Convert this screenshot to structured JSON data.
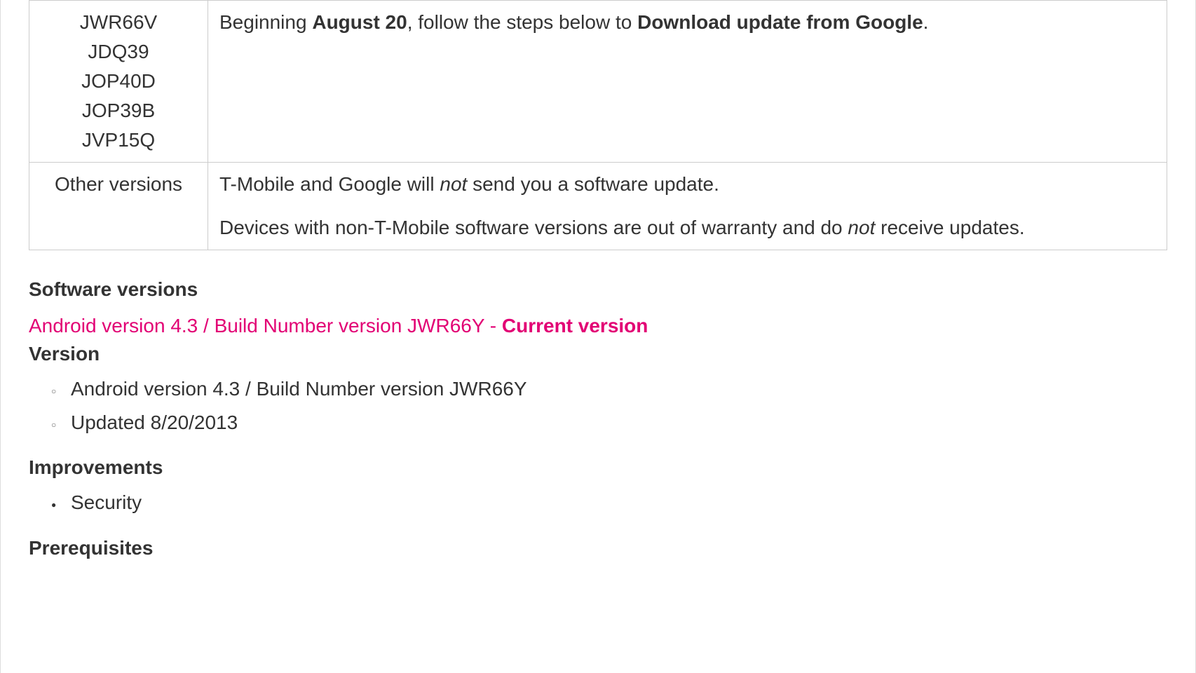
{
  "table": {
    "row1": {
      "builds": [
        "JWR66V",
        "JDQ39",
        "JOP40D",
        "JOP39B",
        "JVP15Q"
      ],
      "text_prefix": "Beginning ",
      "text_bold1": "August 20",
      "text_mid": ", follow the steps below to ",
      "text_bold2": "Download update from Google",
      "text_suffix": "."
    },
    "row2": {
      "label": "Other versions",
      "para1_prefix": "T-Mobile and Google will ",
      "para1_italic": "not",
      "para1_suffix": " send you a software update.",
      "para2_prefix": "Devices with non-T-Mobile software versions are out of warranty and do ",
      "para2_italic": "not",
      "para2_suffix": " receive updates."
    }
  },
  "sections": {
    "software_versions_heading": "Software versions",
    "current_link_text": "Android version 4.3 / Build Number version JWR66Y - ",
    "current_link_bold": "Current version",
    "version_heading": "Version",
    "version_items": [
      "Android version 4.3 / Build Number version JWR66Y",
      "Updated 8/20/2013"
    ],
    "improvements_heading": "Improvements",
    "improvements_items": [
      "Security"
    ],
    "prerequisites_heading": "Prerequisites"
  }
}
